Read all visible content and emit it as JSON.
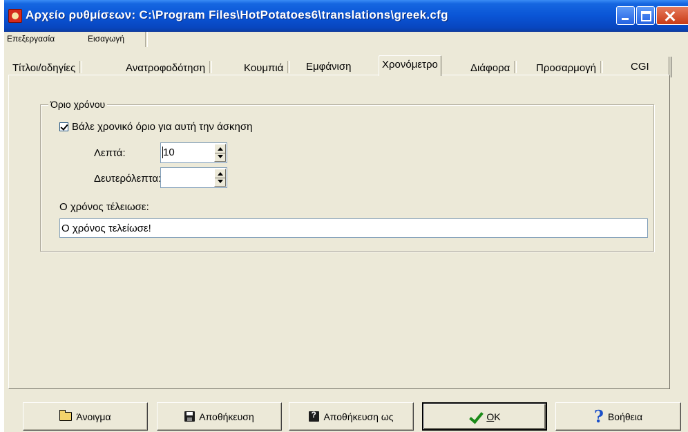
{
  "window": {
    "title": "Αρχείο ρυθμίσεων:  C:\\Program Files\\HotPotatoes6\\translations\\greek.cfg"
  },
  "menu": {
    "items": [
      "Επεξεργασία",
      "Εισαγωγή"
    ]
  },
  "tabs": [
    {
      "label": "Τίτλοι/οδηγίες",
      "active": false
    },
    {
      "label": "Ανατροφοδότηση",
      "active": false
    },
    {
      "label": "Κουμπιά",
      "active": false
    },
    {
      "label": "Εμφάνιση",
      "active": false
    },
    {
      "label": "Χρονόμετρο",
      "active": true
    },
    {
      "label": "Διάφορα",
      "active": false
    },
    {
      "label": "Προσαρμογή",
      "active": false
    },
    {
      "label": "CGI",
      "active": false
    }
  ],
  "timer": {
    "group_title": "Όριο χρόνου",
    "checkbox_label": "Βάλε χρονικό όριο για αυτή την άσκηση",
    "checkbox_checked": true,
    "minutes_label": "Λεπτά:",
    "minutes_value": "10",
    "seconds_label": "Δευτερόλεπτα:",
    "seconds_value": "",
    "timeout_label": "Ο χρόνος τέλειωσε:",
    "timeout_value": "Ο χρόνος τελείωσε!"
  },
  "buttons": {
    "open": "Άνοιγμα",
    "save": "Αποθήκευση",
    "save_as": "Αποθήκευση ως",
    "ok": "OK",
    "help": "Βοήθεια"
  },
  "icons": {
    "open": "folder-icon",
    "save": "disk-icon",
    "save_as": "disk-question-icon",
    "ok": "check-icon",
    "help": "help-icon"
  }
}
